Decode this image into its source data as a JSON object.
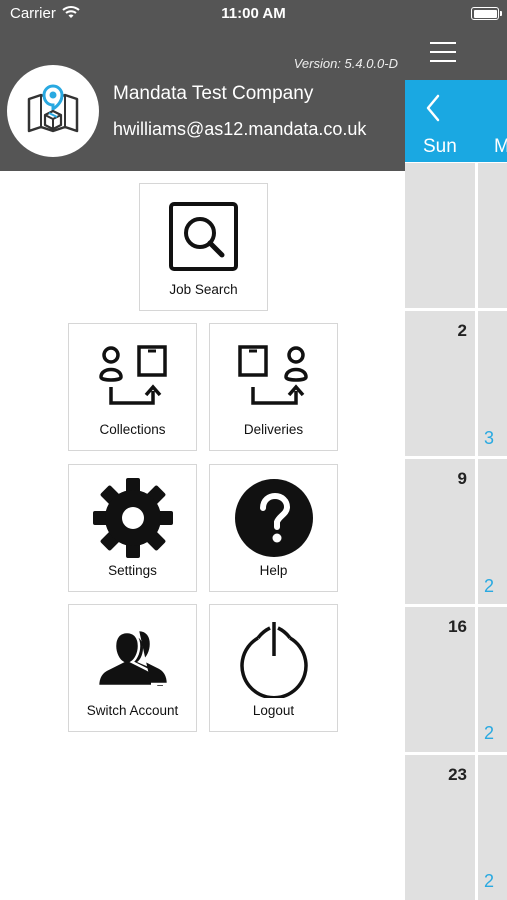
{
  "status_bar": {
    "carrier": "Carrier",
    "time": "11:00 AM"
  },
  "drawer": {
    "version": "Version: 5.4.0.0-D",
    "company": "Mandata Test Company",
    "email": "hwilliams@as12.mandata.co.uk",
    "menu": [
      {
        "label": "Job Search",
        "icon": "job-search-icon"
      },
      {
        "label": "Collections",
        "icon": "collections-icon"
      },
      {
        "label": "Deliveries",
        "icon": "deliveries-icon"
      },
      {
        "label": "Settings",
        "icon": "gear-icon"
      },
      {
        "label": "Help",
        "icon": "help-icon"
      },
      {
        "label": "Switch Account",
        "icon": "switch-account-icon"
      },
      {
        "label": "Logout",
        "icon": "power-icon"
      }
    ]
  },
  "calendar": {
    "days": [
      "Sun",
      "M"
    ],
    "weeks": [
      {
        "date": "",
        "count": ""
      },
      {
        "date": "2",
        "count": "3"
      },
      {
        "date": "9",
        "count": "2"
      },
      {
        "date": "16",
        "count": "2"
      },
      {
        "date": "23",
        "count": "2"
      }
    ]
  },
  "colors": {
    "header_grey": "#555555",
    "accent_blue": "#1aa8e2",
    "cell_grey": "#e0e0e0"
  }
}
